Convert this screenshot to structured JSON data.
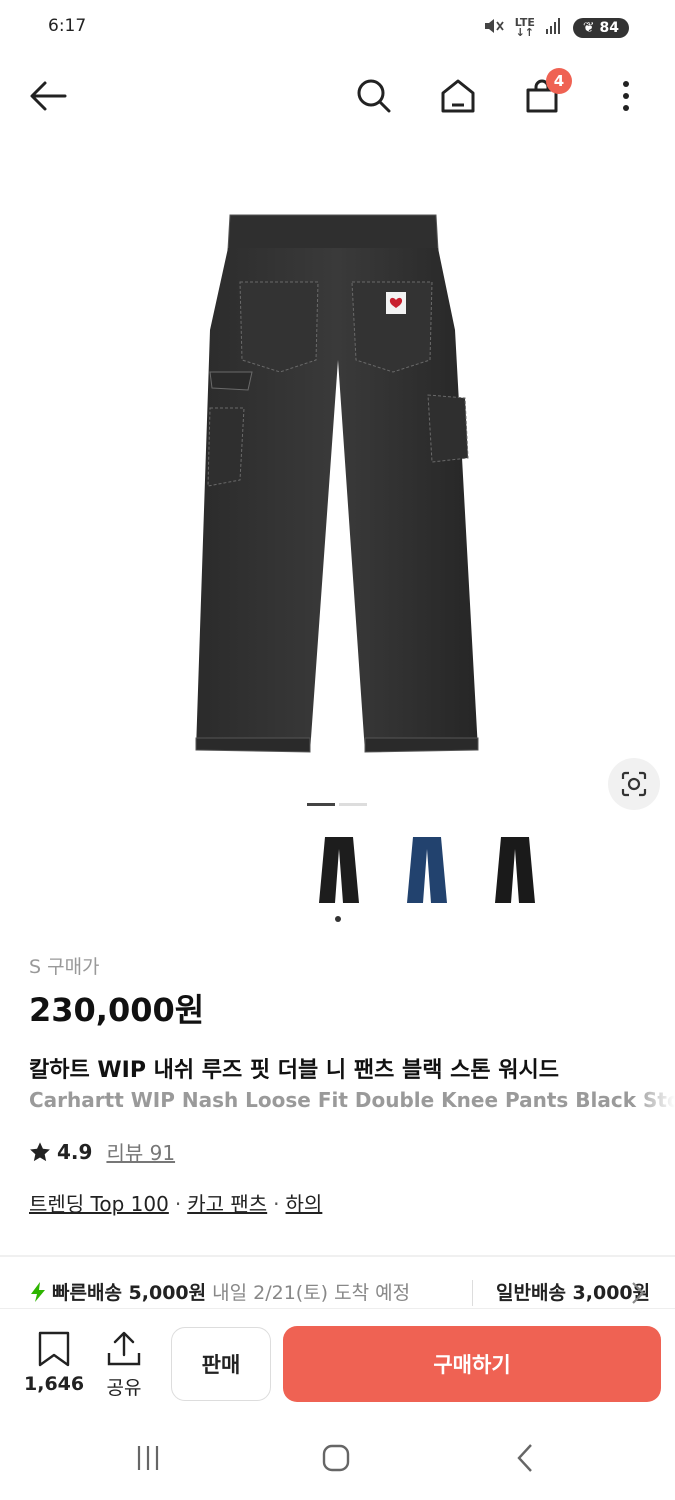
{
  "status": {
    "time": "6:17",
    "network": "LTE",
    "battery": "84"
  },
  "header": {
    "cart_count": "4"
  },
  "gallery": {
    "pages": 2,
    "active_page": 1,
    "thumbnail_colors": [
      "#1d1d1d",
      "#22426e",
      "#1a1a1a"
    ]
  },
  "product": {
    "price_label": "S 구매가",
    "price": "230,000원",
    "title_ko": "칼하트 WIP 내쉬 루즈 핏 더블 니 팬츠 블랙 스톤 워시드",
    "title_en": "Carhartt WIP Nash Loose Fit Double Knee Pants Black Stone Washed",
    "rating": "4.9",
    "review_label": "리뷰 91",
    "tags": [
      "트렌딩 Top 100",
      "카고 팬츠",
      "하의"
    ]
  },
  "shipping": {
    "fast_label": "빠른배송 5,000원",
    "fast_eta": "내일 2/21(토) 도착 예정",
    "normal_label": "일반배송 3,000원"
  },
  "actions": {
    "bookmark_count": "1,646",
    "share_label": "공유",
    "sell_label": "판매",
    "buy_label": "구매하기"
  },
  "colors": {
    "accent": "#ef6253",
    "fast_bolt": "#2db400"
  }
}
